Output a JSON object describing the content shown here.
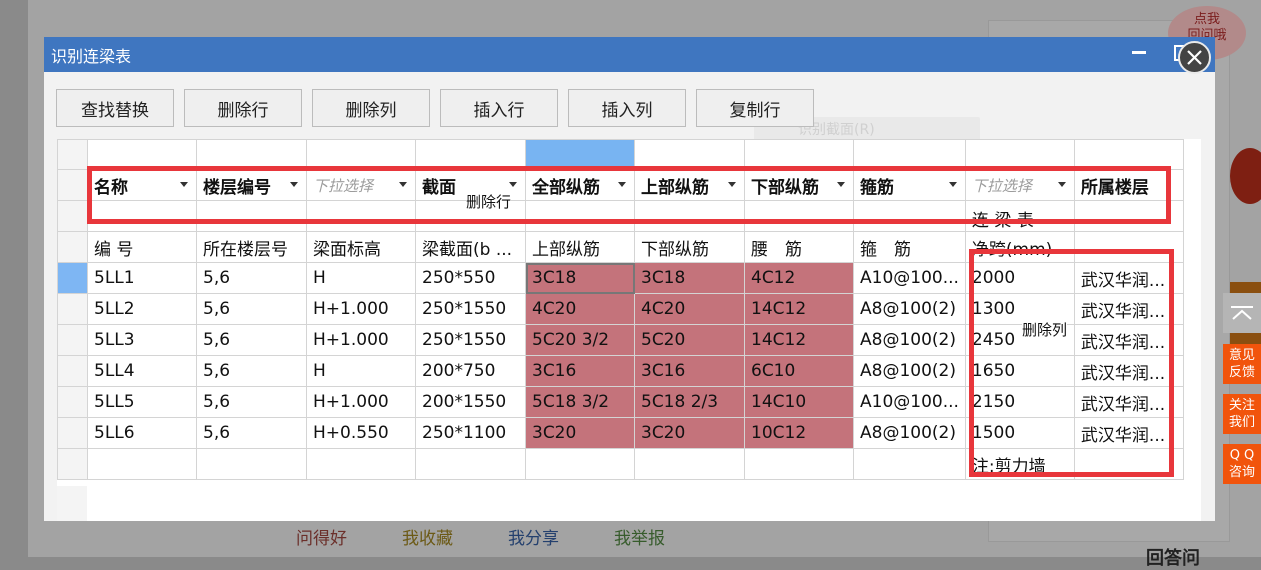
{
  "background": {
    "links": [
      "问得好",
      "我收藏",
      "我分享",
      "我举报"
    ],
    "bubble_text": "点我\n回问哦",
    "bottom_text": "回答问"
  },
  "side_tools": {
    "feedback": "意见\n反馈",
    "follow": "关注\n我们",
    "qq": "Q Q\n咨询"
  },
  "dialog": {
    "title": "识别连梁表",
    "toolbar": [
      "查找替换",
      "删除行",
      "删除列",
      "插入行",
      "插入列",
      "复制行"
    ],
    "ghost_text": "识别截面(R)"
  },
  "grid": {
    "header_row": [
      {
        "label": "名称",
        "placeholder": false
      },
      {
        "label": "楼层编号",
        "placeholder": false
      },
      {
        "label": "下拉选择",
        "placeholder": true
      },
      {
        "label": "截面",
        "placeholder": false
      },
      {
        "label": "全部纵筋",
        "placeholder": false
      },
      {
        "label": "上部纵筋",
        "placeholder": false
      },
      {
        "label": "下部纵筋",
        "placeholder": false
      },
      {
        "label": "箍筋",
        "placeholder": false
      },
      {
        "label": "下拉选择",
        "placeholder": true
      },
      {
        "label": "所属楼层",
        "placeholder": false
      }
    ],
    "title_row_text": "连 梁 表",
    "column_headers": [
      "编 号",
      "所在楼层号",
      "梁面标高",
      "梁截面(b ...",
      "上部纵筋",
      "下部纵筋",
      "腰　筋",
      "箍　筋",
      "净跨(mm)",
      ""
    ],
    "rows": [
      [
        "5LL1",
        "5,6",
        "H",
        "250*550",
        "3C18",
        "3C18",
        "4C12",
        "A10@100...",
        "2000",
        "武汉华润..."
      ],
      [
        "5LL2",
        "5,6",
        "H+1.000",
        "250*1550",
        "4C20",
        "4C20",
        "14C12",
        "A8@100(2)",
        "1300",
        "武汉华润..."
      ],
      [
        "5LL3",
        "5,6",
        "H+1.000",
        "250*1550",
        "5C20 3/2",
        "5C20",
        "14C12",
        "A8@100(2)",
        "2450",
        "武汉华润..."
      ],
      [
        "5LL4",
        "5,6",
        "H",
        "200*750",
        "3C16",
        "3C16",
        "6C10",
        "A8@100(2)",
        "1650",
        "武汉华润..."
      ],
      [
        "5LL5",
        "5,6",
        "H+1.000",
        "200*1550",
        "5C18 3/2",
        "5C18 2/3",
        "14C10",
        "A10@100...",
        "2150",
        "武汉华润..."
      ],
      [
        "5LL6",
        "5,6",
        "H+0.550",
        "250*1100",
        "3C20",
        "3C20",
        "10C12",
        "A8@100(2)",
        "1500",
        "武汉华润..."
      ]
    ],
    "note_text": "注:剪力墙"
  },
  "annotations": {
    "delete_row_label": "删除行",
    "delete_col_label": "删除列"
  },
  "colors": {
    "title_bar": "#3f76c0",
    "highlight_pink": "#c4737b",
    "selected_column": "#78b4f2",
    "annotation_red": "#e8363b",
    "side_orange": "#f1540c"
  }
}
